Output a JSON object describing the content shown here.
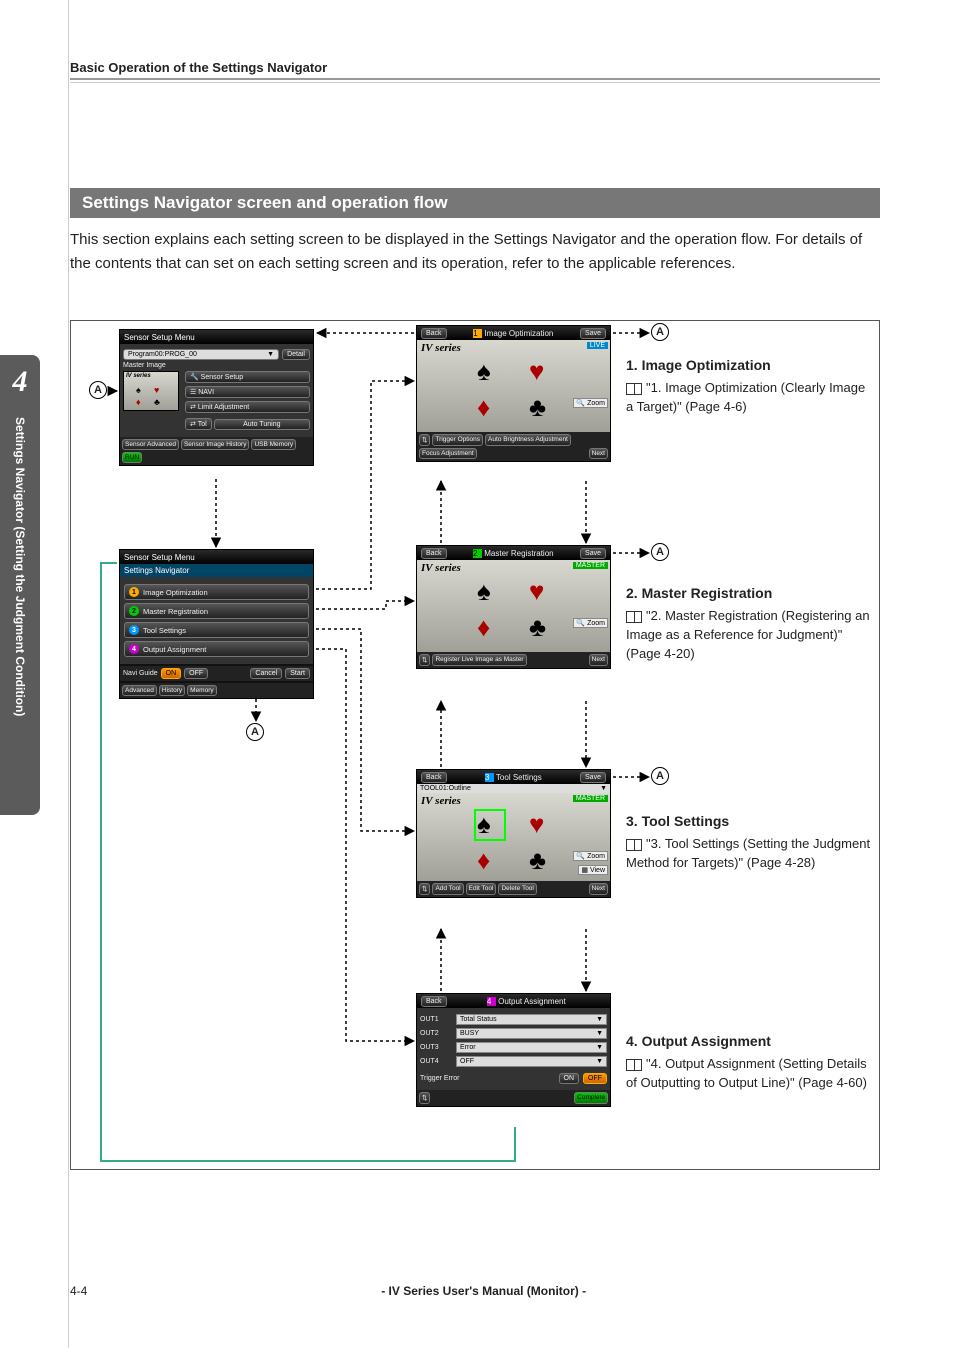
{
  "header": {
    "running_head": "Basic Operation of the Settings Navigator"
  },
  "chapter_tab": {
    "number": "4",
    "title": "Settings Navigator (Setting the Judgment Condition)"
  },
  "section": {
    "title": "Settings Navigator screen and operation flow",
    "intro": "This section explains each setting screen to be displayed in the Settings Navigator and the operation flow. For details of the contents that can set on each setting screen and its operation, refer to the applicable references."
  },
  "marker": "A",
  "sensor_menu": {
    "title": "Sensor Setup Menu",
    "program": "Program00:PROG_00",
    "detail_btn": "Detail",
    "master_label": "Master Image",
    "brand": "IV series",
    "sensor_setup_btn": "Sensor Setup",
    "navi_btn": "NAVI",
    "limit_btn": "Limit Adjustment",
    "tol_btn": "Tol",
    "auto_tuning_btn": "Auto Tuning",
    "foot": {
      "sensor_adv": "Sensor Advanced",
      "sensor_hist": "Sensor Image History",
      "usb_mem": "USB Memory",
      "run": "RUN"
    }
  },
  "nav_screen": {
    "title": "Sensor Setup Menu",
    "subtitle": "Settings Navigator",
    "items": [
      "Image Optimization",
      "Master Registration",
      "Tool Settings",
      "Output Assignment"
    ],
    "navi_guide": "Navi Guide",
    "on": "ON",
    "off": "OFF",
    "cancel": "Cancel",
    "start": "Start",
    "advanced": "Advanced",
    "history": "History",
    "memory": "Memory"
  },
  "screens": {
    "brand": "IV series",
    "back": "Back",
    "save": "Save",
    "next": "Next",
    "zoom": "Zoom",
    "s1": {
      "title": "Image Optimization",
      "badge": "LIVE",
      "foot": [
        "Trigger Options",
        "Auto Brightness Adjustment",
        "Focus Adjustment"
      ]
    },
    "s2": {
      "title": "Master Registration",
      "badge": "MASTER",
      "foot": [
        "Register Live Image as Master"
      ]
    },
    "s3": {
      "title": "Tool Settings",
      "badge": "MASTER",
      "tool_sel": "TOOL01:Outline",
      "view": "View",
      "foot": [
        "Add Tool",
        "Edit Tool",
        "Delete Tool"
      ]
    },
    "s4": {
      "title": "Output Assignment",
      "rows": [
        {
          "lbl": "OUT1",
          "val": "Total Status"
        },
        {
          "lbl": "OUT2",
          "val": "BUSY"
        },
        {
          "lbl": "OUT3",
          "val": "Error"
        },
        {
          "lbl": "OUT4",
          "val": "OFF"
        }
      ],
      "trig_err": "Trigger Error",
      "on": "ON",
      "off": "OFF",
      "complete": "Complete"
    }
  },
  "descriptions": {
    "d1": {
      "h": "1. Image Optimization",
      "ref": "\"1. Image Optimization (Clearly Image a Target)\" (Page 4-6)"
    },
    "d2": {
      "h": "2. Master Registration",
      "ref": "\"2. Master Registration (Registering an Image as a Reference for Judgment)\" (Page 4-20)"
    },
    "d3": {
      "h": "3. Tool Settings",
      "ref": "\"3. Tool Settings (Setting the Judgment Method for Targets)\" (Page 4-28)"
    },
    "d4": {
      "h": "4. Output Assignment",
      "ref": "\"4. Output Assignment (Setting Details of Outputting to Output Line)\" (Page 4-60)"
    }
  },
  "footer": {
    "page": "4-4",
    "center": "- IV Series User's Manual (Monitor) -"
  }
}
